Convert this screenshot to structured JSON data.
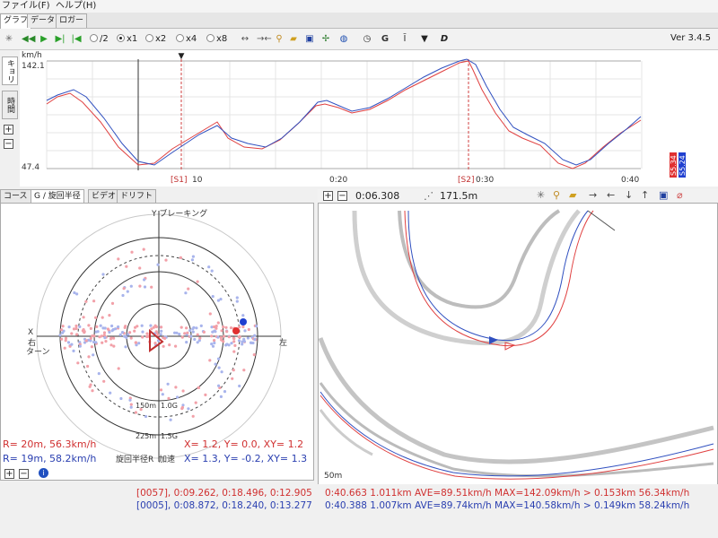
{
  "menu": {
    "file": "ファイル(F)",
    "help": "ヘルプ(H)"
  },
  "tabs": [
    "グラフ",
    "データ",
    "ロガー"
  ],
  "toolbar": {
    "speed_options": [
      "/2",
      "x1",
      "x2",
      "x4",
      "x8"
    ],
    "selected_speed": "x1",
    "version": "Ver 3.4.5"
  },
  "vertical_tabs": [
    "キョリ",
    "時間"
  ],
  "graph": {
    "unit": "km/h",
    "y_max_label": "142.1",
    "y_min_label": "47.4",
    "x_labels": [
      "10",
      "0:20",
      "0:30",
      "0:40"
    ],
    "markers": [
      "[S1]",
      "[S2]"
    ],
    "legend": [
      {
        "label": "S5.34",
        "color": "#e03030"
      },
      {
        "label": "S5.24",
        "color": "#2040d0"
      }
    ]
  },
  "bottom_tabs": [
    "コース",
    "G / 旋回半径",
    "ビデオ",
    "ドリフト"
  ],
  "gcircle": {
    "top_label": "Y ブレーキング",
    "left_label_x": "X",
    "left_label_turn": "右\nターン",
    "right_label": "左",
    "ring_label_1": "150m",
    "ring_label_1g": "1.0G",
    "ring_label_2": "225m",
    "ring_label_2g": "1.5G",
    "bottom_radius": "旋回半径R",
    "bottom_accel": "加速",
    "readout_red_r": "R=  20m,  56.3km/h",
    "readout_blue_r": "R=  19m,  58.2km/h",
    "readout_red_g": "X=  1.2,  Y=   0.0,  XY= 1.2",
    "readout_blue_g": "X=  1.3,  Y=  -0.2,  XY= 1.3"
  },
  "map": {
    "time": "0:06.308",
    "distance": "171.5m",
    "scale": "50m"
  },
  "stats": {
    "red_laps": "[0057], 0:09.262, 0:18.496, 0:12.905",
    "blue_laps": "[0005], 0:08.872, 0:18.240, 0:13.277",
    "red_summary": "0:40.663 1.011km AVE=89.51km/h MAX=142.09km/h > 0.153km 56.34km/h",
    "blue_summary": "0:40.388 1.007km AVE=89.74km/h MAX=140.58km/h > 0.149km 58.24km/h"
  },
  "colors": {
    "red": "#d03030",
    "blue": "#2a3fb0"
  }
}
